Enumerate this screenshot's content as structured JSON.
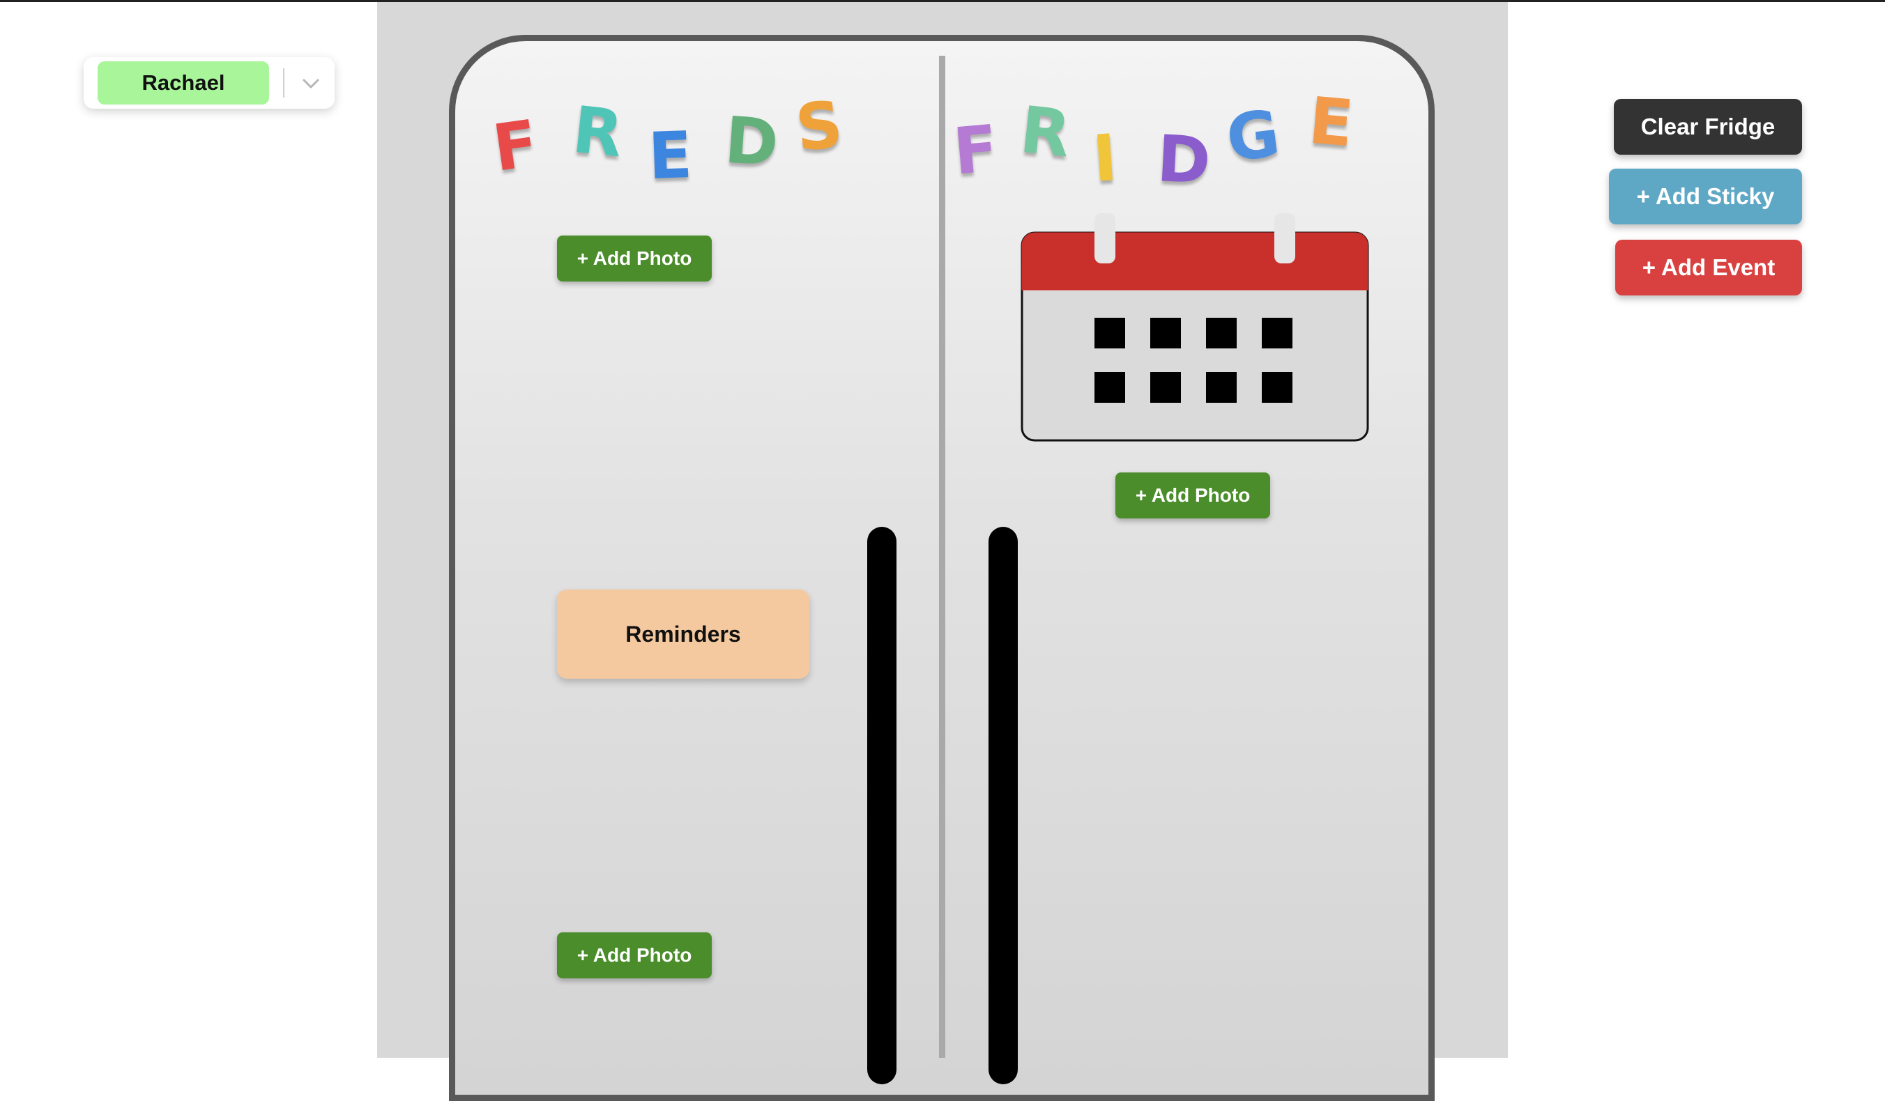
{
  "user_selector": {
    "selected_user": "Rachael",
    "chevron_icon": "chevron-down-icon"
  },
  "title_left": {
    "letters": [
      "F",
      "R",
      "E",
      "D",
      "S"
    ],
    "colors": [
      "#e84a4a",
      "#4fc5b8",
      "#3d86e0",
      "#64b07a",
      "#f0a23a"
    ]
  },
  "title_right": {
    "letters": [
      "F",
      "R",
      "I",
      "D",
      "G",
      "E"
    ],
    "colors": [
      "#b57ad4",
      "#74c8a0",
      "#f0c53a",
      "#8b5ccc",
      "#4f8fe0",
      "#f29a4a"
    ]
  },
  "left_door": {
    "add_photo_top_label": "+ Add Photo",
    "reminders_label": "Reminders",
    "add_photo_bottom_label": "+ Add Photo"
  },
  "right_door": {
    "calendar_icon": "calendar-icon",
    "add_photo_label": "+ Add Photo"
  },
  "actions": {
    "clear_label": "Clear Fridge",
    "add_sticky_label": "+ Add Sticky",
    "add_event_label": "+ Add Event"
  },
  "colors": {
    "photo_button": "#4a8d2a",
    "clear_button": "#333333",
    "sticky_button": "#5ea8c6",
    "event_button": "#d94040",
    "user_pill": "#a8f59a",
    "reminder_note": "#f5c9a0",
    "calendar_header": "#c9302c"
  }
}
